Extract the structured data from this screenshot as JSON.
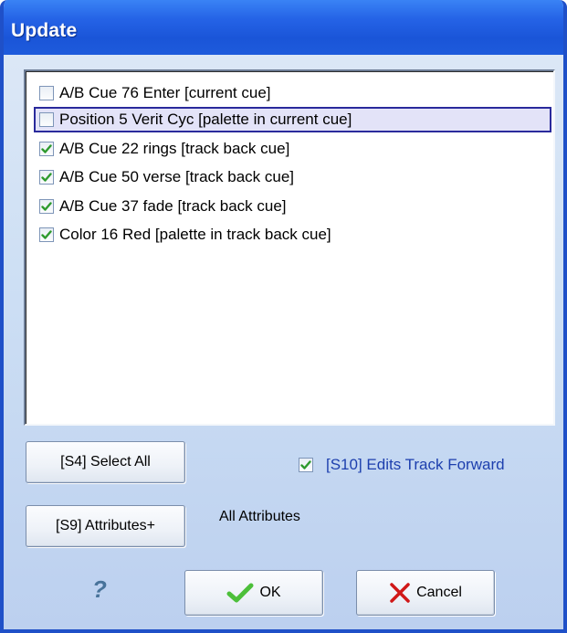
{
  "window": {
    "title": "Update"
  },
  "list": {
    "items": [
      {
        "label": "A/B Cue 76 Enter [current cue]",
        "checked": false,
        "selected": false
      },
      {
        "label": "Position 5 Verit Cyc [palette in current cue]",
        "checked": false,
        "selected": true
      },
      {
        "label": "A/B Cue 22 rings [track back cue]",
        "checked": true,
        "selected": false
      },
      {
        "label": "A/B Cue 50 verse [track back cue]",
        "checked": true,
        "selected": false
      },
      {
        "label": "A/B Cue 37 fade [track back cue]",
        "checked": true,
        "selected": false
      },
      {
        "label": "Color 16 Red [palette in track back cue]",
        "checked": true,
        "selected": false
      }
    ]
  },
  "buttons": {
    "select_all": "[S4] Select All",
    "attributes": "[S9] Attributes+",
    "ok": "OK",
    "cancel": "Cancel"
  },
  "attributes_label": "All Attributes",
  "track_forward": {
    "label": "[S10] Edits Track Forward",
    "checked": true
  },
  "help": {
    "glyph": "?"
  },
  "icons": {
    "check": "green-check-icon",
    "cancel": "red-x-icon"
  },
  "colors": {
    "titlebar": "#2563e6",
    "check": "#2e9a2e",
    "cancel_x": "#d01818",
    "link_text": "#1d3fae"
  }
}
